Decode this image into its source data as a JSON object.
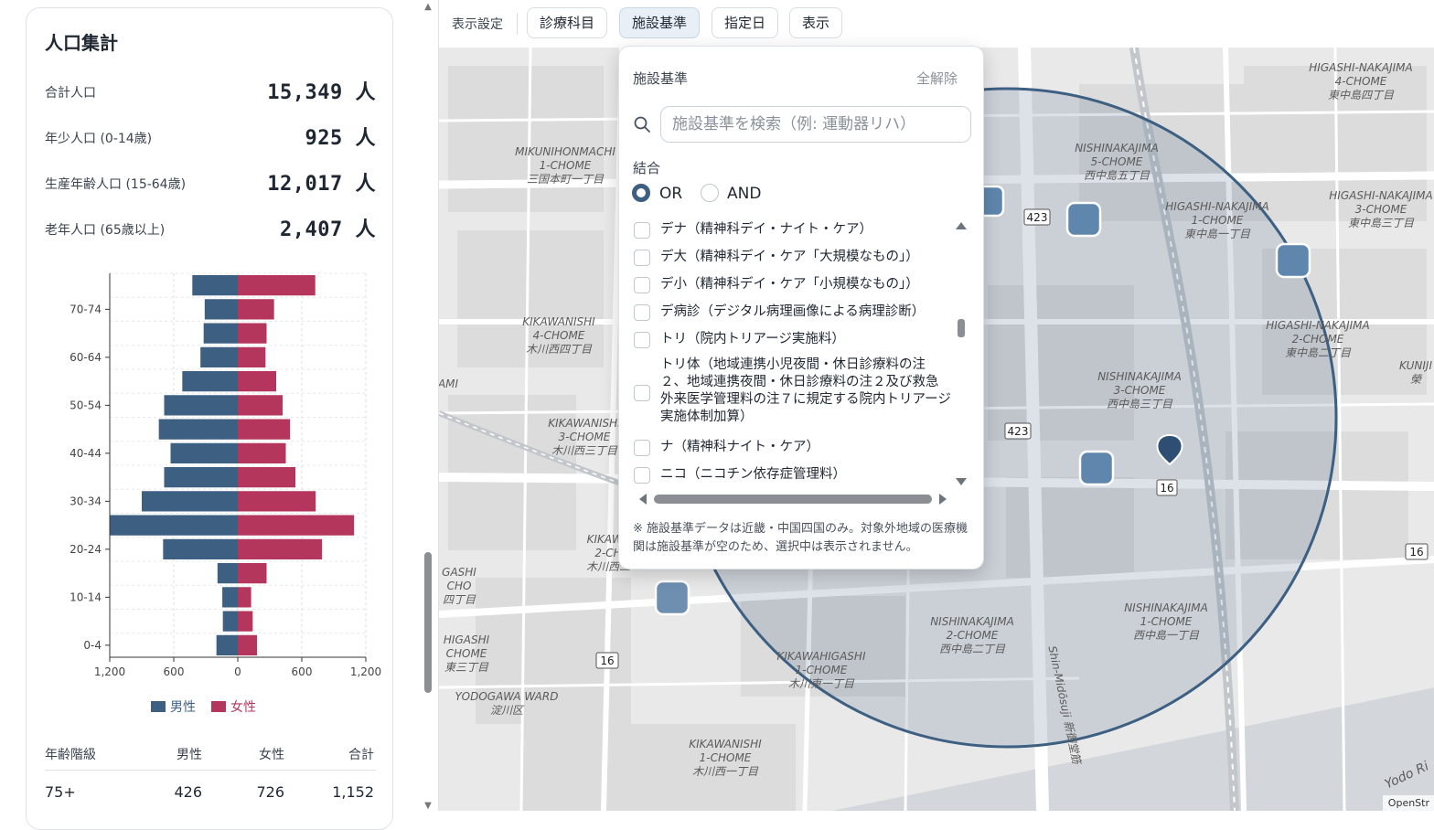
{
  "summary": {
    "title": "人口集計",
    "rows": [
      {
        "label": "合計人口",
        "value": "15,349 人"
      },
      {
        "label": "年少人口 (0-14歳)",
        "value": "925 人"
      },
      {
        "label": "生産年齢人口 (15-64歳)",
        "value": "12,017 人"
      },
      {
        "label": "老年人口 (65歳以上)",
        "value": "2,407 人"
      }
    ]
  },
  "chart_data": {
    "type": "bar",
    "orientation": "horizontal-pyramid",
    "categories": [
      "0-4",
      "5-9",
      "10-14",
      "15-19",
      "20-24",
      "25-29",
      "30-34",
      "35-39",
      "40-44",
      "45-49",
      "50-54",
      "55-59",
      "60-64",
      "65-69",
      "70-74",
      "75+"
    ],
    "y_tick_labels": [
      "0-4",
      "10-14",
      "20-24",
      "30-34",
      "40-44",
      "50-54",
      "60-64",
      "70-74"
    ],
    "series": [
      {
        "name": "男性",
        "color": "#3d5f82",
        "values": [
          200,
          140,
          145,
          190,
          700,
          1200,
          900,
          690,
          630,
          740,
          690,
          520,
          350,
          320,
          310,
          426
        ]
      },
      {
        "name": "女性",
        "color": "#b5365c",
        "values": [
          180,
          140,
          125,
          270,
          790,
          1090,
          730,
          540,
          450,
          490,
          420,
          360,
          260,
          270,
          340,
          726
        ]
      }
    ],
    "x_ticks": [
      "1,200",
      "600",
      "0",
      "600",
      "1,200"
    ],
    "xlim": [
      -1200,
      1200
    ],
    "grid": true,
    "legend_position": "bottom"
  },
  "age_table": {
    "headers": [
      "年齢階級",
      "男性",
      "女性",
      "合計"
    ],
    "rows": [
      [
        "75+",
        "426",
        "726",
        "1,152"
      ]
    ]
  },
  "toolbar": {
    "label": "表示設定",
    "buttons": [
      "診療科目",
      "施設基準",
      "指定日",
      "表示"
    ]
  },
  "dropdown": {
    "title": "施設基準",
    "clear_label": "全解除",
    "search_placeholder": "施設基準を検索（例: 運動器リハ）",
    "combine_label": "結合",
    "combine_options": [
      "OR",
      "AND"
    ],
    "combine_selected": "OR",
    "items": [
      "デナ（精神科デイ・ナイト・ケア）",
      "デ大（精神科デイ・ケア「大規模なもの」）",
      "デ小（精神科デイ・ケア「小規模なもの」）",
      "デ病診（デジタル病理画像による病理診断）",
      "トリ（院内トリアージ実施料）",
      "トリ体（地域連携小児夜間・休日診療料の注２、地域連携夜間・休日診療料の注２及び救急外来医学管理料の注７に規定する院内トリアージ実施体制加算）",
      "ナ（精神科ナイト・ケア）",
      "ニコ（ニコチン依存症管理料）"
    ],
    "note": "※ 施設基準データは近畿・中国四国のみ。対象外地域の医療機関は施設基準が空のため、選択中は表示されません。"
  },
  "map": {
    "labels": [
      {
        "lines": [
          "HIGASHI-NAKAJIMA",
          "4-CHOME",
          "東中島四丁目"
        ]
      },
      {
        "lines": [
          "NISHINAKAJIMA",
          "5-CHOME",
          "西中島五丁目"
        ]
      },
      {
        "lines": [
          "HIGASHI-NAKAJIMA",
          "1-CHOME",
          "東中島一丁目"
        ]
      },
      {
        "lines": [
          "HIGASHI-NAKAJIMA",
          "3-CHOME",
          "東中島三丁目"
        ]
      },
      {
        "lines": [
          "MIKUNIHONMACHI",
          "1-CHOME",
          "三国本町一丁目"
        ]
      },
      {
        "lines": [
          "KIKAWANISHI",
          "4-CHOME",
          "木川西四丁目"
        ]
      },
      {
        "lines": [
          "HIGASHI-NAKAJIMA",
          "2-CHOME",
          "東中島二丁目"
        ]
      },
      {
        "lines": [
          "NISHINAKAJIMA",
          "3-CHOME",
          "西中島三丁目"
        ]
      },
      {
        "lines": [
          "KIKAWANISHI",
          "3-CHOME",
          "木川西三丁目"
        ]
      },
      {
        "lines": [
          "KIKAWA",
          "2-CH",
          "木川西二"
        ]
      },
      {
        "lines": [
          "NISHINAKAJIMA",
          "1-CHOME",
          "西中島一丁目"
        ]
      },
      {
        "lines": [
          "NISHINAKAJIMA",
          "2-CHOME",
          "西中島二丁目"
        ]
      },
      {
        "lines": [
          "KIKAWAHIGASHI",
          "1-CHOME",
          "木川東一丁目"
        ]
      },
      {
        "lines": [
          "YODOGAWA WARD",
          "淀川区"
        ]
      },
      {
        "lines": [
          "KIKAWANISHI",
          "1-CHOME",
          "木川西一丁目"
        ]
      },
      {
        "lines": [
          "HIGASHI",
          "CHOME",
          "東三丁目"
        ]
      },
      {
        "lines": [
          "GASHI",
          "CHO",
          "四丁目"
        ]
      },
      {
        "lines": [
          "KUNIJI",
          "榮"
        ]
      },
      {
        "lines": [
          "AMI"
        ]
      },
      {
        "lines": [
          "Shin-Midōsuji 新御堂筋"
        ]
      },
      {
        "lines": [
          "Yodo Ri"
        ]
      }
    ],
    "route_badges": [
      "423",
      "423",
      "16",
      "16",
      "16"
    ],
    "attribution": "OpenStr"
  }
}
